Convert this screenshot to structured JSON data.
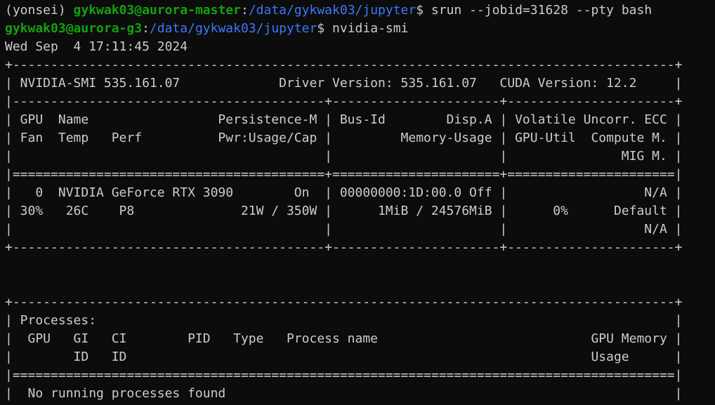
{
  "theme": {
    "background": "#0c0c0c",
    "foreground": "#cccccc",
    "user_host_color": "#13a10e",
    "path_color": "#3b78ff"
  },
  "prompt1": {
    "env": "(yonsei) ",
    "user_host": "gykwak03@aurora-master",
    "colon": ":",
    "path": "/data/gykwak03/jupyter",
    "suffix": "$ ",
    "command": "srun --jobid=31628 --pty bash"
  },
  "prompt2": {
    "user_host": "gykwak03@aurora-g3",
    "colon": ":",
    "path": "/data/gykwak03/jupyter",
    "suffix": "$ ",
    "command": "nvidia-smi"
  },
  "output": {
    "timestamp": "Wed Sep  4 17:11:45 2024",
    "gpu_table": [
      "+---------------------------------------------------------------------------------------+",
      "| NVIDIA-SMI 535.161.07             Driver Version: 535.161.07   CUDA Version: 12.2     |",
      "|-----------------------------------------+----------------------+----------------------+",
      "| GPU  Name                 Persistence-M | Bus-Id        Disp.A | Volatile Uncorr. ECC |",
      "| Fan  Temp   Perf          Pwr:Usage/Cap |         Memory-Usage | GPU-Util  Compute M. |",
      "|                                         |                      |               MIG M. |",
      "|=========================================+======================+======================|",
      "|   0  NVIDIA GeForce RTX 3090        On  | 00000000:1D:00.0 Off |                  N/A |",
      "| 30%   26C    P8              21W / 350W |      1MiB / 24576MiB |      0%      Default |",
      "|                                         |                      |                  N/A |",
      "+-----------------------------------------+----------------------+----------------------+"
    ],
    "blank_lines": [
      "",
      ""
    ],
    "process_table": [
      "+---------------------------------------------------------------------------------------+",
      "| Processes:                                                                            |",
      "|  GPU   GI   CI        PID   Type   Process name                            GPU Memory |",
      "|        ID   ID                                                             Usage      |",
      "|=======================================================================================|",
      "|  No running processes found                                                           |",
      "+---------------------------------------------------------------------------------------+"
    ]
  }
}
